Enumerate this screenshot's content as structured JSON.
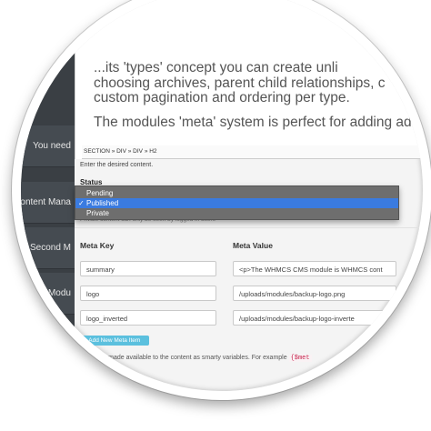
{
  "sidebar": {
    "items": [
      {
        "label": "You need"
      },
      {
        "label": "ontent Mana"
      },
      {
        "label": "Second M"
      },
      {
        "label": "t Modu"
      }
    ]
  },
  "editor": {
    "line1": "...its 'types' concept you can create unli",
    "line2": "choosing archives, parent child relationships, c",
    "line3": "custom pagination and ordering per type.",
    "line4": "The modules 'meta' system is perfect for adding addi",
    "path": "SECTION » DIV » DIV » H2",
    "help": "Enter the desired content."
  },
  "status": {
    "label": "Status",
    "options": [
      "Pending",
      "Published",
      "Private"
    ],
    "selected": "Published",
    "hint": "Private content can only be seen by logged in users"
  },
  "meta": {
    "key_header": "Meta Key",
    "value_header": "Meta Value",
    "rows": [
      {
        "key": "summary",
        "value": "<p>The WHMCS CMS module is WHMCS cont"
      },
      {
        "key": "logo",
        "value": "/uploads/modules/backup-logo.png"
      },
      {
        "key": "logo_inverted",
        "value": "/uploads/modules/backup-logo-inverte"
      }
    ],
    "add_button": "+ Add New Meta Item",
    "footer_text": "...ues are made available to the content as smarty variables. For example",
    "footer_code": "{$met"
  }
}
